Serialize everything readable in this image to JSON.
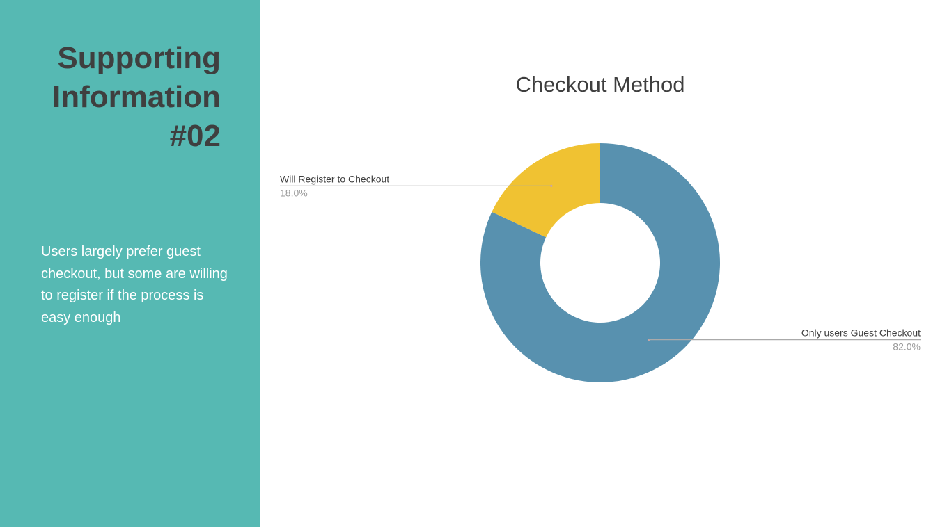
{
  "slide": {
    "heading_line1": "Supporting",
    "heading_line2": "Information",
    "heading_line3": "#02",
    "body": "Users largely prefer guest checkout, but some are willing to register if the process is easy enough"
  },
  "colors": {
    "panel": "#56b9b3",
    "heading_text": "#3f3f3f",
    "body_text": "#ffffff"
  },
  "chart_data": {
    "type": "pie",
    "donut": true,
    "title": "Checkout Method",
    "labels": [
      "Only users Guest Checkout",
      "Will Register to Checkout"
    ],
    "values": [
      82.0,
      18.0
    ],
    "value_labels": [
      "82.0%",
      "18.0%"
    ],
    "colors": [
      "#5891af",
      "#f0c232"
    ],
    "legend": "none"
  }
}
